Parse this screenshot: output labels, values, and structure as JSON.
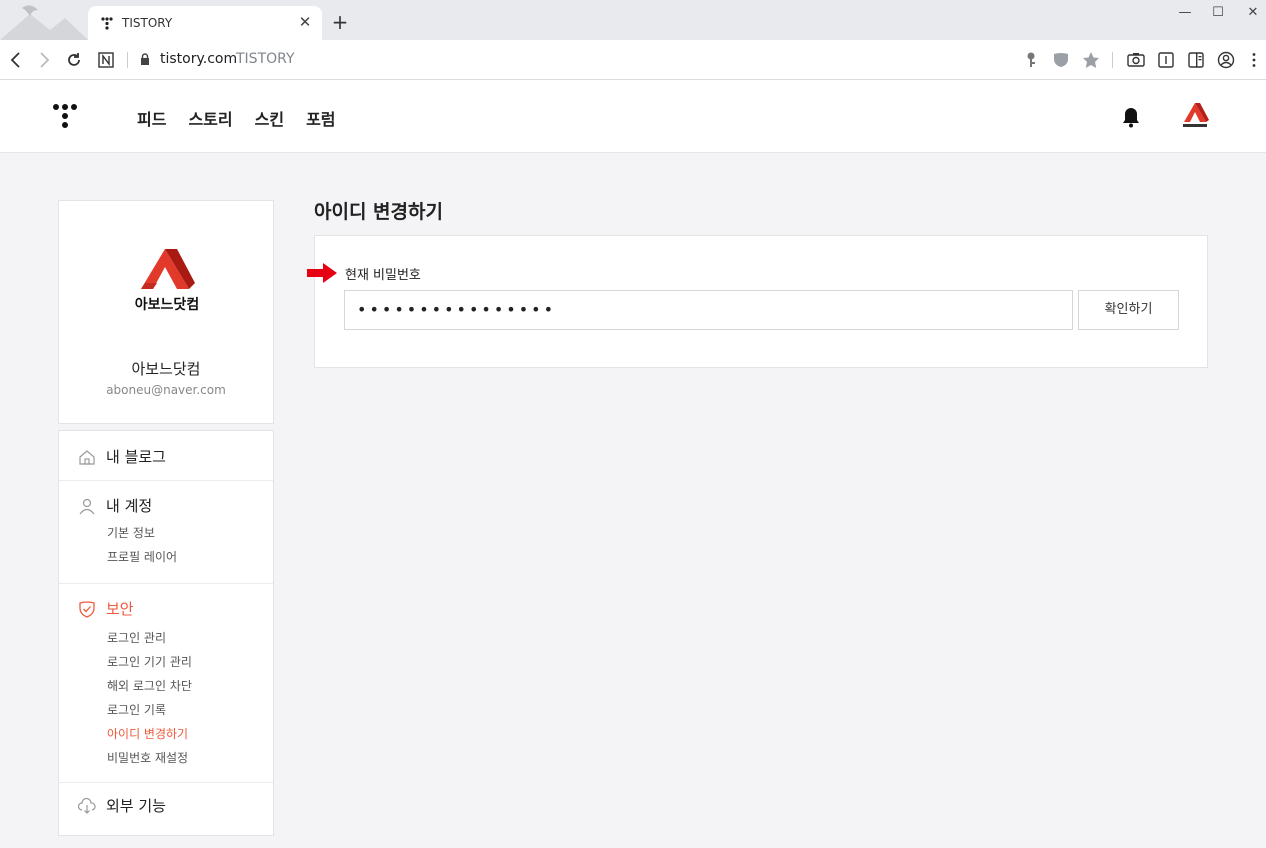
{
  "browser": {
    "tab_title": "TISTORY",
    "tab_close": "✕",
    "new_tab": "+",
    "host": "tistory.com",
    "page_title": "TISTORY",
    "window_minimize": "—",
    "window_maximize": "☐",
    "window_close": "✕"
  },
  "header": {
    "nav": [
      "피드",
      "스토리",
      "스킨",
      "포럼"
    ]
  },
  "profile": {
    "logo_text": "아보느닷컴",
    "name": "아보느닷컴",
    "email": "aboneu@naver.com"
  },
  "sidebar": {
    "my_blog": "내 블로그",
    "account": {
      "title": "내 계정",
      "items": [
        "기본 정보",
        "프로필 레이어"
      ]
    },
    "security": {
      "title": "보안",
      "items": [
        "로그인 관리",
        "로그인 기기 관리",
        "해외 로그인 차단",
        "로그인 기록",
        "아이디 변경하기",
        "비밀번호 재설정"
      ],
      "active_index": 4
    },
    "external": "외부 기능"
  },
  "main": {
    "title": "아이디 변경하기",
    "field_label": "현재 비밀번호",
    "password_value": "••••••••••••••••",
    "confirm_button": "확인하기"
  },
  "colors": {
    "accent": "#ef5a3c",
    "arrow": "#e60012"
  }
}
